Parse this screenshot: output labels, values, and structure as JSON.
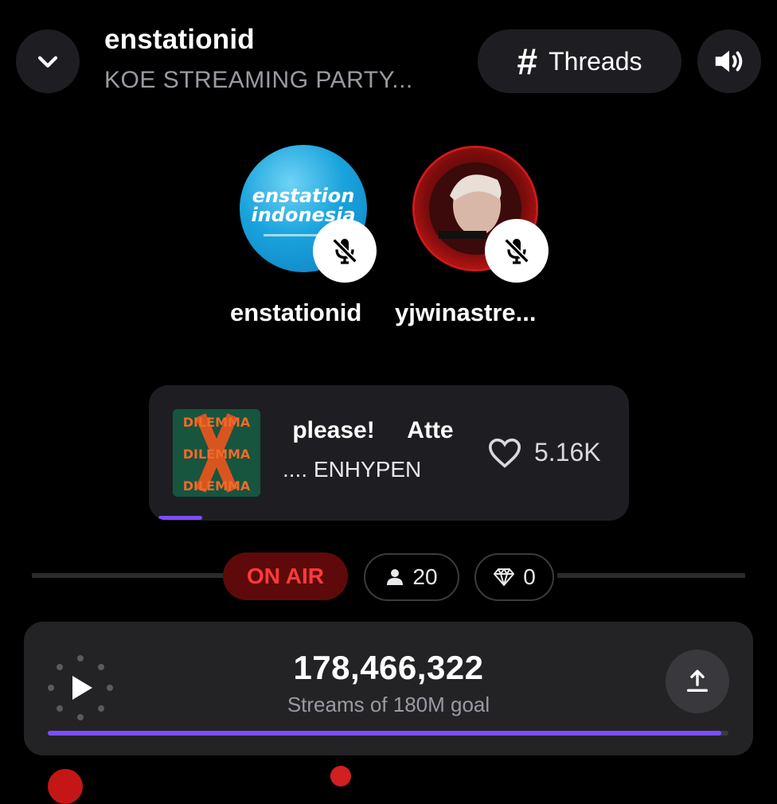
{
  "header": {
    "owner": "enstationid",
    "room_title": "KOE STREAMING PARTY...",
    "threads_label": "Threads",
    "threads_icon": "#"
  },
  "speakers": [
    {
      "name": "enstationid",
      "avatar_text_1": "enstation",
      "avatar_text_2": "indonesia",
      "muted": true
    },
    {
      "name": "yjwinastre...",
      "muted": true
    }
  ],
  "now_playing": {
    "title": " please!     Atte",
    "artist": ".... ENHYPEN",
    "album_text": "DILEMMA",
    "likes": "5.16K",
    "progress_percent": 6
  },
  "status": {
    "on_air_label": "ON AIR",
    "listeners": "20",
    "gems": "0"
  },
  "streams": {
    "count": "178,466,322",
    "goal_label": "Streams of 180M goal",
    "goal_progress_percent": 99
  },
  "colors": {
    "accent": "#7c4dff",
    "on_air_bg": "#5e0a0a",
    "on_air_text": "#ff3a3a",
    "card_bg": "#1e1e22"
  },
  "icons": {
    "back": "chevron-down-icon",
    "volume": "volume-icon",
    "mute": "mic-off-icon",
    "like": "heart-icon",
    "listeners": "person-icon",
    "gems": "diamond-icon",
    "play": "play-icon",
    "share": "share-icon"
  }
}
